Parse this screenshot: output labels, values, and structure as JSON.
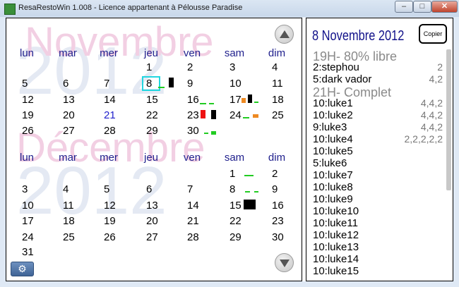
{
  "window": {
    "title": "ResaRestoWin 1.008 - Licence appartenant à Pélousse Paradise"
  },
  "titlebar_buttons": {
    "minimize": "–",
    "maximize": "□",
    "close": "✕"
  },
  "calendar": {
    "weekdays": [
      "lun",
      "mar",
      "mer",
      "jeu",
      "ven",
      "sam",
      "dim"
    ],
    "months": [
      {
        "watermark_name": "Novembre",
        "watermark_year": "2012",
        "weeks": [
          [
            "",
            "",
            "",
            "1",
            "2",
            "3",
            "4"
          ],
          [
            "5",
            "6",
            "7",
            "8",
            "9",
            "10",
            "11"
          ],
          [
            "12",
            "13",
            "14",
            "15",
            "16",
            "17",
            "18"
          ],
          [
            "19",
            "20",
            "21",
            "22",
            "23",
            "24",
            "25"
          ],
          [
            "26",
            "27",
            "28",
            "29",
            "30",
            "",
            ""
          ]
        ],
        "today": "21",
        "selected": "8"
      },
      {
        "watermark_name": "Décembre",
        "watermark_year": "2012",
        "weeks": [
          [
            "",
            "",
            "",
            "",
            "",
            "1",
            "2"
          ],
          [
            "3",
            "4",
            "5",
            "6",
            "7",
            "8",
            "9"
          ],
          [
            "10",
            "11",
            "12",
            "13",
            "14",
            "15",
            "16"
          ],
          [
            "17",
            "18",
            "19",
            "20",
            "21",
            "22",
            "23"
          ],
          [
            "24",
            "25",
            "26",
            "27",
            "28",
            "29",
            "30"
          ],
          [
            "31",
            "",
            "",
            "",
            "",
            "",
            ""
          ]
        ]
      }
    ]
  },
  "day_panel": {
    "title": "8 Novembre 2012",
    "copy_label": "Copier",
    "entries": [
      {
        "kind": "header",
        "text": "19H- 80% libre"
      },
      {
        "kind": "item",
        "name": "2:stephou",
        "sizes": "2"
      },
      {
        "kind": "item",
        "name": "5:dark vador",
        "sizes": "4,2"
      },
      {
        "kind": "header",
        "text": "21H- Complet"
      },
      {
        "kind": "item",
        "name": "10:luke1",
        "sizes": "4,4,2"
      },
      {
        "kind": "item",
        "name": "10:luke2",
        "sizes": "4,4,2"
      },
      {
        "kind": "item",
        "name": "9:luke3",
        "sizes": "4,4,2"
      },
      {
        "kind": "item",
        "name": "10:luke4",
        "sizes": "2,2,2,2,2"
      },
      {
        "kind": "item",
        "name": "10:luke5",
        "sizes": ""
      },
      {
        "kind": "item",
        "name": "5:luke6",
        "sizes": ""
      },
      {
        "kind": "item",
        "name": "10:luke7",
        "sizes": ""
      },
      {
        "kind": "item",
        "name": "10:luke8",
        "sizes": ""
      },
      {
        "kind": "item",
        "name": "10:luke9",
        "sizes": ""
      },
      {
        "kind": "item",
        "name": "10:luke10",
        "sizes": ""
      },
      {
        "kind": "item",
        "name": "10:luke11",
        "sizes": ""
      },
      {
        "kind": "item",
        "name": "10:luke12",
        "sizes": ""
      },
      {
        "kind": "item",
        "name": "10:luke13",
        "sizes": ""
      },
      {
        "kind": "item",
        "name": "10:luke14",
        "sizes": ""
      },
      {
        "kind": "item",
        "name": "10:luke15",
        "sizes": ""
      }
    ]
  },
  "colors": {
    "green": "#22cc22",
    "black": "#000000",
    "red": "#ee1111",
    "orange": "#ee8a22",
    "selected_outline": "#22d6e0",
    "today": "#2222cc",
    "header_text": "#1f1f8c"
  }
}
